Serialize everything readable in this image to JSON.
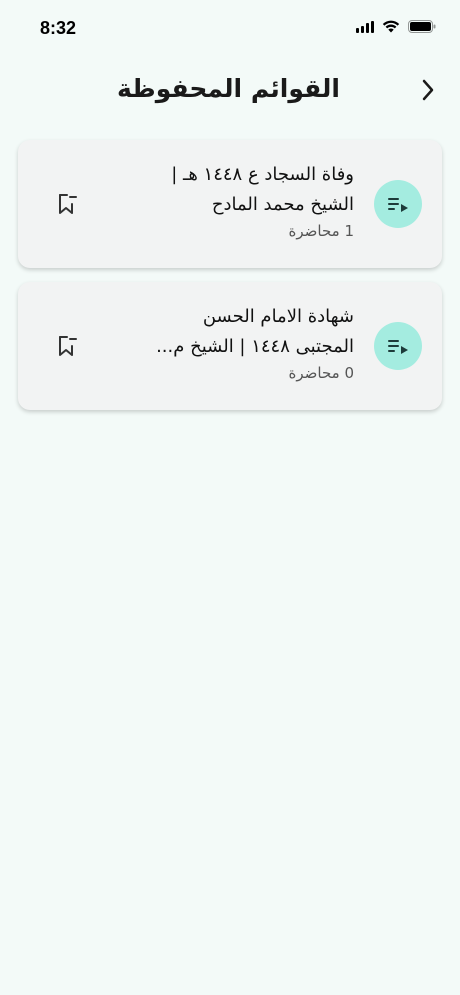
{
  "status": {
    "time": "8:32"
  },
  "header": {
    "title": "القوائم المحفوظة"
  },
  "playlists": [
    {
      "title_line1": "وفاة السجاد ع ١٤٤٨ هـ |",
      "title_line2": "الشيخ محمد المادح",
      "count": "1 محاضرة"
    },
    {
      "title_line1": "شهادة الامام الحسن",
      "title_line2": "المجتبى ١٤٤٨ | الشيخ م...",
      "count": "0 محاضرة"
    }
  ],
  "colors": {
    "accent": "#a4ece0",
    "background": "#f3faf8",
    "card": "#f2f3f3"
  },
  "icons": {
    "back": "chevron-right-icon",
    "playlist": "playlist-play-icon",
    "bookmark": "bookmark-remove-icon"
  }
}
